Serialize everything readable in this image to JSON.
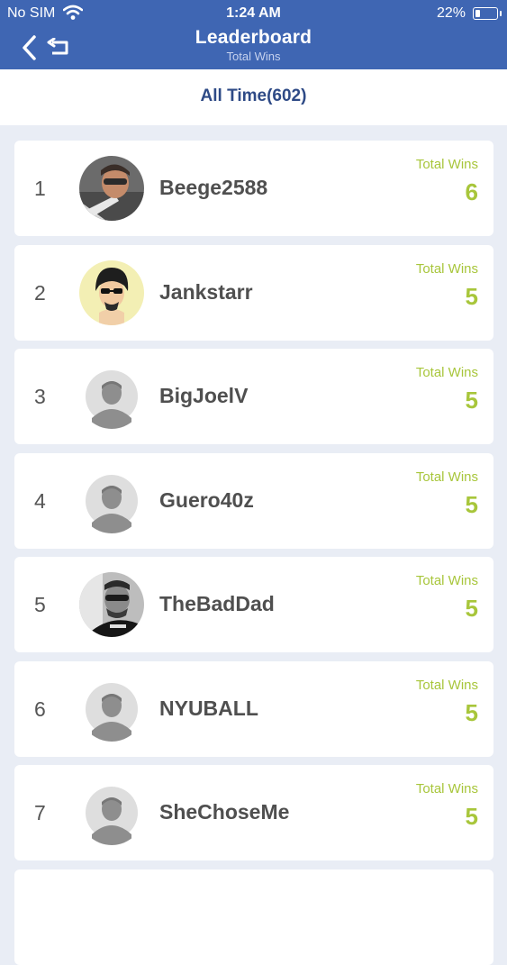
{
  "status_bar": {
    "carrier": "No SIM",
    "time": "1:24 AM",
    "battery": "22%",
    "battery_level": 0.22
  },
  "header": {
    "title": "Leaderboard",
    "subtitle": "Total Wins",
    "color": "#3f66b3"
  },
  "filter": {
    "label": "All Time(602)"
  },
  "wins_label": "Total Wins",
  "accent_color": "#a8c63b",
  "players": [
    {
      "rank": "1",
      "name": "Beege2588",
      "wins": "6",
      "avatar": "photo-avatar-man"
    },
    {
      "rank": "2",
      "name": "Jankstarr",
      "wins": "5",
      "avatar": "cartoon-avatar"
    },
    {
      "rank": "3",
      "name": "BigJoelV",
      "wins": "5",
      "avatar": "default-avatar"
    },
    {
      "rank": "4",
      "name": "Guero40z",
      "wins": "5",
      "avatar": "default-avatar"
    },
    {
      "rank": "5",
      "name": "TheBadDad",
      "wins": "5",
      "avatar": "photo-avatar-man-bw"
    },
    {
      "rank": "6",
      "name": "NYUBALL",
      "wins": "5",
      "avatar": "default-avatar"
    },
    {
      "rank": "7",
      "name": "SheChoseMe",
      "wins": "5",
      "avatar": "default-avatar"
    }
  ]
}
